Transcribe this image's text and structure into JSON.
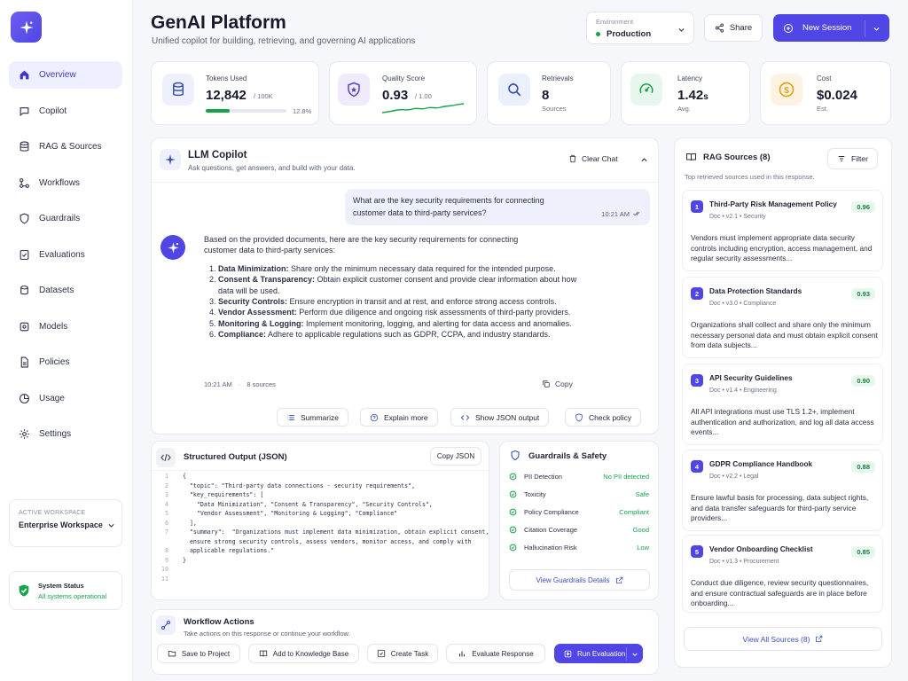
{
  "app": {
    "title": "GenAI Platform",
    "subtitle": "Unified copilot for building, retrieving, and governing AI applications"
  },
  "colors": {
    "accent": "#5046e5",
    "success": "#16a34a",
    "warning": "#f59e0b"
  },
  "sidebar": {
    "items": [
      {
        "label": "Overview",
        "icon": "home-icon",
        "active": true
      },
      {
        "label": "Copilot",
        "icon": "chat-icon"
      },
      {
        "label": "RAG & Sources",
        "icon": "database-icon"
      },
      {
        "label": "Workflows",
        "icon": "workflow-icon"
      },
      {
        "label": "Guardrails",
        "icon": "shield-icon"
      },
      {
        "label": "Evaluations",
        "icon": "checklist-icon"
      },
      {
        "label": "Datasets",
        "icon": "dataset-icon"
      },
      {
        "label": "Models",
        "icon": "cube-icon"
      },
      {
        "label": "Policies",
        "icon": "document-icon"
      },
      {
        "label": "Usage",
        "icon": "pie-chart-icon"
      },
      {
        "label": "Settings",
        "icon": "gear-icon"
      }
    ],
    "workspace": {
      "label": "ACTIVE WORKSPACE",
      "value": "Enterprise Workspace"
    },
    "status": {
      "label": "System Status",
      "value": "All systems operational"
    }
  },
  "header": {
    "environment": {
      "label": "Environment",
      "value": "Production"
    },
    "share_label": "Share",
    "new_session_label": "New Session"
  },
  "metrics": [
    {
      "label": "Tokens Used",
      "value": "12,842",
      "suffix": "/ 100K",
      "percent": "12.8%",
      "progress": 0.128
    },
    {
      "label": "Quality Score",
      "value": "0.93",
      "suffix": "/ 1.00"
    },
    {
      "label": "Retrievals",
      "value": "8",
      "sub": "Sources"
    },
    {
      "label": "Latency",
      "value": "1.42",
      "unit": "s",
      "sub": "Avg."
    },
    {
      "label": "Cost",
      "value": "$0.024",
      "sub": "Est."
    }
  ],
  "copilot": {
    "title": "LLM Copilot",
    "subtitle": "Ask questions, get answers, and build with your data.",
    "clear_label": "Clear Chat",
    "user_message": "What are the key security requirements for connecting customer data to third-party services?",
    "user_time": "10:21 AM",
    "ai_intro": "Based on the provided documents, here are the key security requirements for connecting customer data to third-party services:",
    "ai_points": [
      {
        "title": "Data Minimization:",
        "text": " Share only the minimum necessary data required for the intended purpose."
      },
      {
        "title": "Consent & Transparency:",
        "text": " Obtain explicit customer consent and provide clear information about how data will be used."
      },
      {
        "title": "Security Controls:",
        "text": " Ensure encryption in transit and at rest, and enforce strong access controls."
      },
      {
        "title": "Vendor Assessment:",
        "text": " Perform due diligence and ongoing risk assessments of third-party providers."
      },
      {
        "title": "Monitoring & Logging:",
        "text": " Implement monitoring, logging, and alerting for data access and anomalies."
      },
      {
        "title": "Compliance:",
        "text": " Adhere to applicable regulations such as GDPR, CCPA, and industry standards."
      }
    ],
    "ai_time": "10:21 AM",
    "ai_sources": "8 sources",
    "copy_label": "Copy",
    "actions": [
      "Summarize",
      "Explain more",
      "Show JSON output",
      "Check policy"
    ]
  },
  "structured": {
    "title": "Structured Output (JSON)",
    "copy_label": "Copy JSON",
    "line_numbers": [
      "1",
      "2",
      "3",
      "4",
      "5",
      "6",
      "7",
      "8",
      "9",
      "10",
      "11"
    ],
    "lines": [
      "{",
      "  \"topic\": \"Third-party data connections - security requirements\",",
      "  \"key_requirements\": [",
      "    \"Data Minimization\", \"Consent & Transparency\", \"Security Controls\",",
      "    \"Vendor Assessment\", \"Monitoring & Logging\", \"Compliance\"",
      "  ],",
      "  \"summary\":  \"Organizations must implement data minimization, obtain explicit consent,",
      "  ensure strong security controls, assess vendors, monitor access, and comply with",
      "  applicable regulations.\"",
      "}",
      ""
    ]
  },
  "guardrails": {
    "title": "Guardrails & Safety",
    "rows": [
      {
        "label": "PII Detection",
        "value": "No PII detected"
      },
      {
        "label": "Toxicity",
        "value": "Safe"
      },
      {
        "label": "Policy Compliance",
        "value": "Compliant"
      },
      {
        "label": "Citation Coverage",
        "value": "Good"
      },
      {
        "label": "Hallucination Risk",
        "value": "Low"
      }
    ],
    "details_label": "View Guardrails Details"
  },
  "workflow": {
    "title": "Workflow Actions",
    "subtitle": "Take actions on this response or continue your workflow.",
    "actions": [
      "Save to Project",
      "Add to Knowledge Base",
      "Create Task",
      "Evaluate Response"
    ],
    "run_label": "Run Evaluation"
  },
  "rag": {
    "title": "RAG Sources (8)",
    "subtitle": "Top retrieved sources used in this response.",
    "filter_label": "Filter",
    "sources": [
      {
        "num": "1",
        "title": "Third-Party Risk Management Policy",
        "meta": "Doc  •  v2.1  •  Security",
        "score": "0.96",
        "desc": "Vendors must implement appropriate data security controls including encryption, access management, and regular security assessments..."
      },
      {
        "num": "2",
        "title": "Data Protection Standards",
        "meta": "Doc  •  v3.0  •  Compliance",
        "score": "0.93",
        "desc": "Organizations shall collect and share only the minimum necessary personal data and must obtain explicit consent from data subjects..."
      },
      {
        "num": "3",
        "title": "API Security Guidelines",
        "meta": "Doc  •  v1.4  •  Engineering",
        "score": "0.90",
        "desc": "All API integrations must use TLS 1.2+, implement authentication and authorization, and log all data access events..."
      },
      {
        "num": "4",
        "title": "GDPR Compliance Handbook",
        "meta": "Doc  •  v2.2  •  Legal",
        "score": "0.88",
        "desc": "Ensure lawful basis for processing, data subject rights, and data transfer safeguards for third-party service providers..."
      },
      {
        "num": "5",
        "title": "Vendor Onboarding Checklist",
        "meta": "Doc  •  v1.3  •  Procurement",
        "score": "0.85",
        "desc": "Conduct due diligence, review security questionnaires, and ensure contractual safeguards are in place before onboarding..."
      }
    ],
    "view_all_label": "View All Sources (8)"
  }
}
